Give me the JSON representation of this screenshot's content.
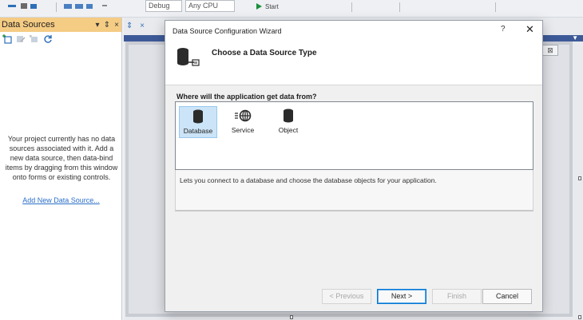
{
  "ds_panel": {
    "title": "Data Sources",
    "pin_icon": "pin-icon",
    "close_glyph": "×",
    "message": "Your project currently has no data sources associated with it. Add a new data source, then data-bind items by dragging from this window onto forms or existing controls.",
    "link": "Add New Data Source..."
  },
  "toolbar": {
    "config_value": "Debug",
    "platform_value": "Any CPU",
    "start_label": "Start"
  },
  "editor": {
    "tab_glyphs": "⇕ ×"
  },
  "wizard": {
    "title": "Data Source Configuration Wizard",
    "help_glyph": "?",
    "close_glyph": "✕",
    "heading": "Choose a Data Source Type",
    "question": "Where will the application get data from?",
    "types": [
      {
        "label": "Database",
        "icon": "database-icon",
        "selected": true
      },
      {
        "label": "Service",
        "icon": "service-icon",
        "selected": false
      },
      {
        "label": "Object",
        "icon": "object-icon",
        "selected": false
      }
    ],
    "description": "Lets you connect to a database and choose the database objects for your application.",
    "buttons": {
      "previous": "< Previous",
      "next": "Next >",
      "finish": "Finish",
      "cancel": "Cancel"
    }
  },
  "colors": {
    "panel_header": "#f5cc84",
    "selection": "#cce4f7",
    "accent": "#0078d4",
    "link": "#2b6fc9"
  }
}
